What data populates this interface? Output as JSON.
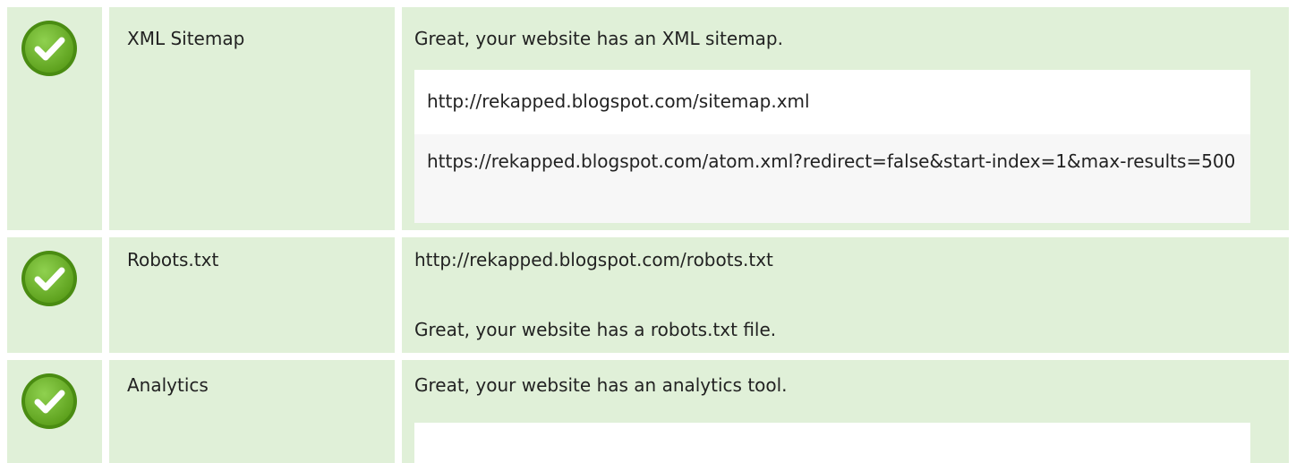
{
  "colors": {
    "row_background": "#e0f0d8",
    "check_fill": "#6ab023",
    "check_border": "#4a8c12",
    "text": "#222222"
  },
  "rows": [
    {
      "name": "XML Sitemap",
      "status_icon": "check-circle-icon",
      "message": "Great, your website has an XML sitemap.",
      "urls": [
        "http://rekapped.blogspot.com/sitemap.xml",
        "https://rekapped.blogspot.com/atom.xml?redirect=false&start-index=1&max-results=500"
      ]
    },
    {
      "name": "Robots.txt",
      "status_icon": "check-circle-icon",
      "url": "http://rekapped.blogspot.com/robots.txt",
      "message": "Great, your website has a robots.txt file."
    },
    {
      "name": "Analytics",
      "status_icon": "check-circle-icon",
      "message": "Great, your website has an analytics tool."
    }
  ]
}
